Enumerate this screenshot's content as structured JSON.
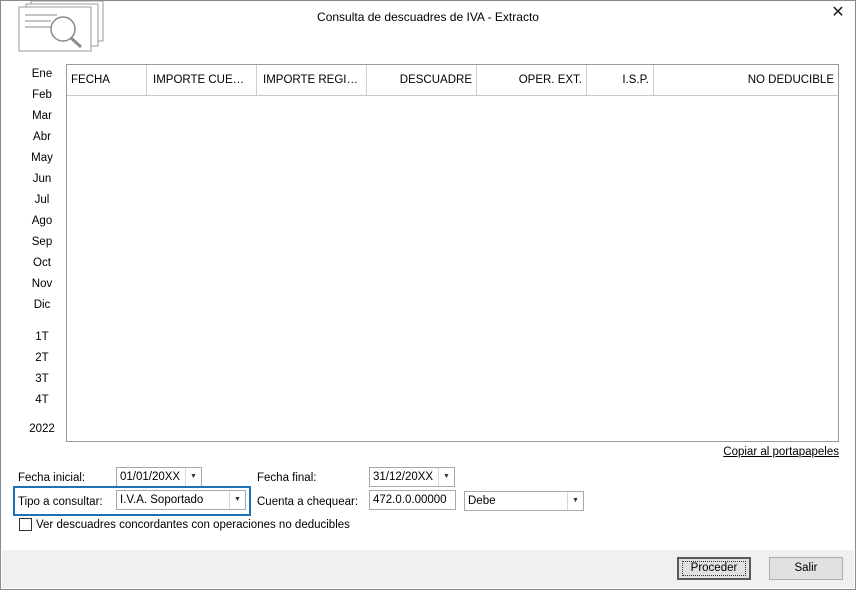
{
  "window": {
    "title": "Consulta de descuadres de IVA - Extracto",
    "close_label": "✕"
  },
  "periods": {
    "months": [
      "Ene",
      "Feb",
      "Mar",
      "Abr",
      "May",
      "Jun",
      "Jul",
      "Ago",
      "Sep",
      "Oct",
      "Nov",
      "Dic"
    ],
    "quarters": [
      "1T",
      "2T",
      "3T",
      "4T"
    ],
    "year": "2022"
  },
  "grid": {
    "columns": [
      "FECHA",
      "IMPORTE CUENTA",
      "IMPORTE REGISTRO",
      "DESCUADRE",
      "OPER. EXT.",
      "I.S.P.",
      "NO DEDUCIBLE"
    ],
    "rows": []
  },
  "copy_link": "Copiar al portapapeles",
  "form": {
    "fecha_inicial_label": "Fecha inicial:",
    "fecha_inicial_value": "01/01/20XX",
    "fecha_final_label": "Fecha final:",
    "fecha_final_value": "31/12/20XX",
    "tipo_label": "Tipo a consultar:",
    "tipo_value": "I.V.A. Soportado",
    "cuenta_label": "Cuenta a chequear:",
    "cuenta_value": "472.0.0.00000",
    "debe_value": "Debe",
    "checkbox_label": "Ver descuadres concordantes con operaciones no deducibles"
  },
  "buttons": {
    "proceder": "Proceder",
    "salir": "Salir"
  },
  "colors": {
    "highlight": "#1a72b8"
  }
}
